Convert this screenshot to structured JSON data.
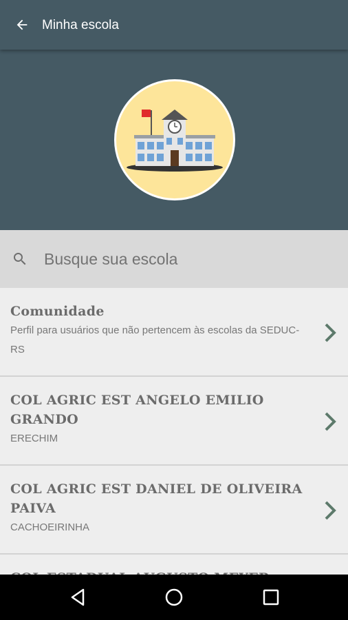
{
  "toolbar": {
    "title": "Minha escola",
    "back_icon": "arrow-left-icon"
  },
  "hero": {
    "emblem_icon": "school-building-icon",
    "emblem_bg": "#fde59a"
  },
  "search": {
    "placeholder": "Busque sua escola",
    "value": "",
    "icon": "search-icon"
  },
  "schools": [
    {
      "name": "Comunidade",
      "subtitle": "Perfil para usuários que não pertencem às escolas da SEDUC-RS"
    },
    {
      "name": "COL AGRIC EST ANGELO EMILIO GRANDO",
      "subtitle": "ERECHIM"
    },
    {
      "name": "COL AGRIC EST DANIEL DE OLIVEIRA PAIVA",
      "subtitle": "CACHOEIRINHA"
    },
    {
      "name": "COL ESTADUAL AUGUSTO MEYER",
      "subtitle": ""
    }
  ],
  "navbar": {
    "back": "back-triangle-icon",
    "home": "home-circle-icon",
    "recents": "recents-square-icon"
  },
  "colors": {
    "primary": "#455a64",
    "accent": "#5d7a6b"
  }
}
